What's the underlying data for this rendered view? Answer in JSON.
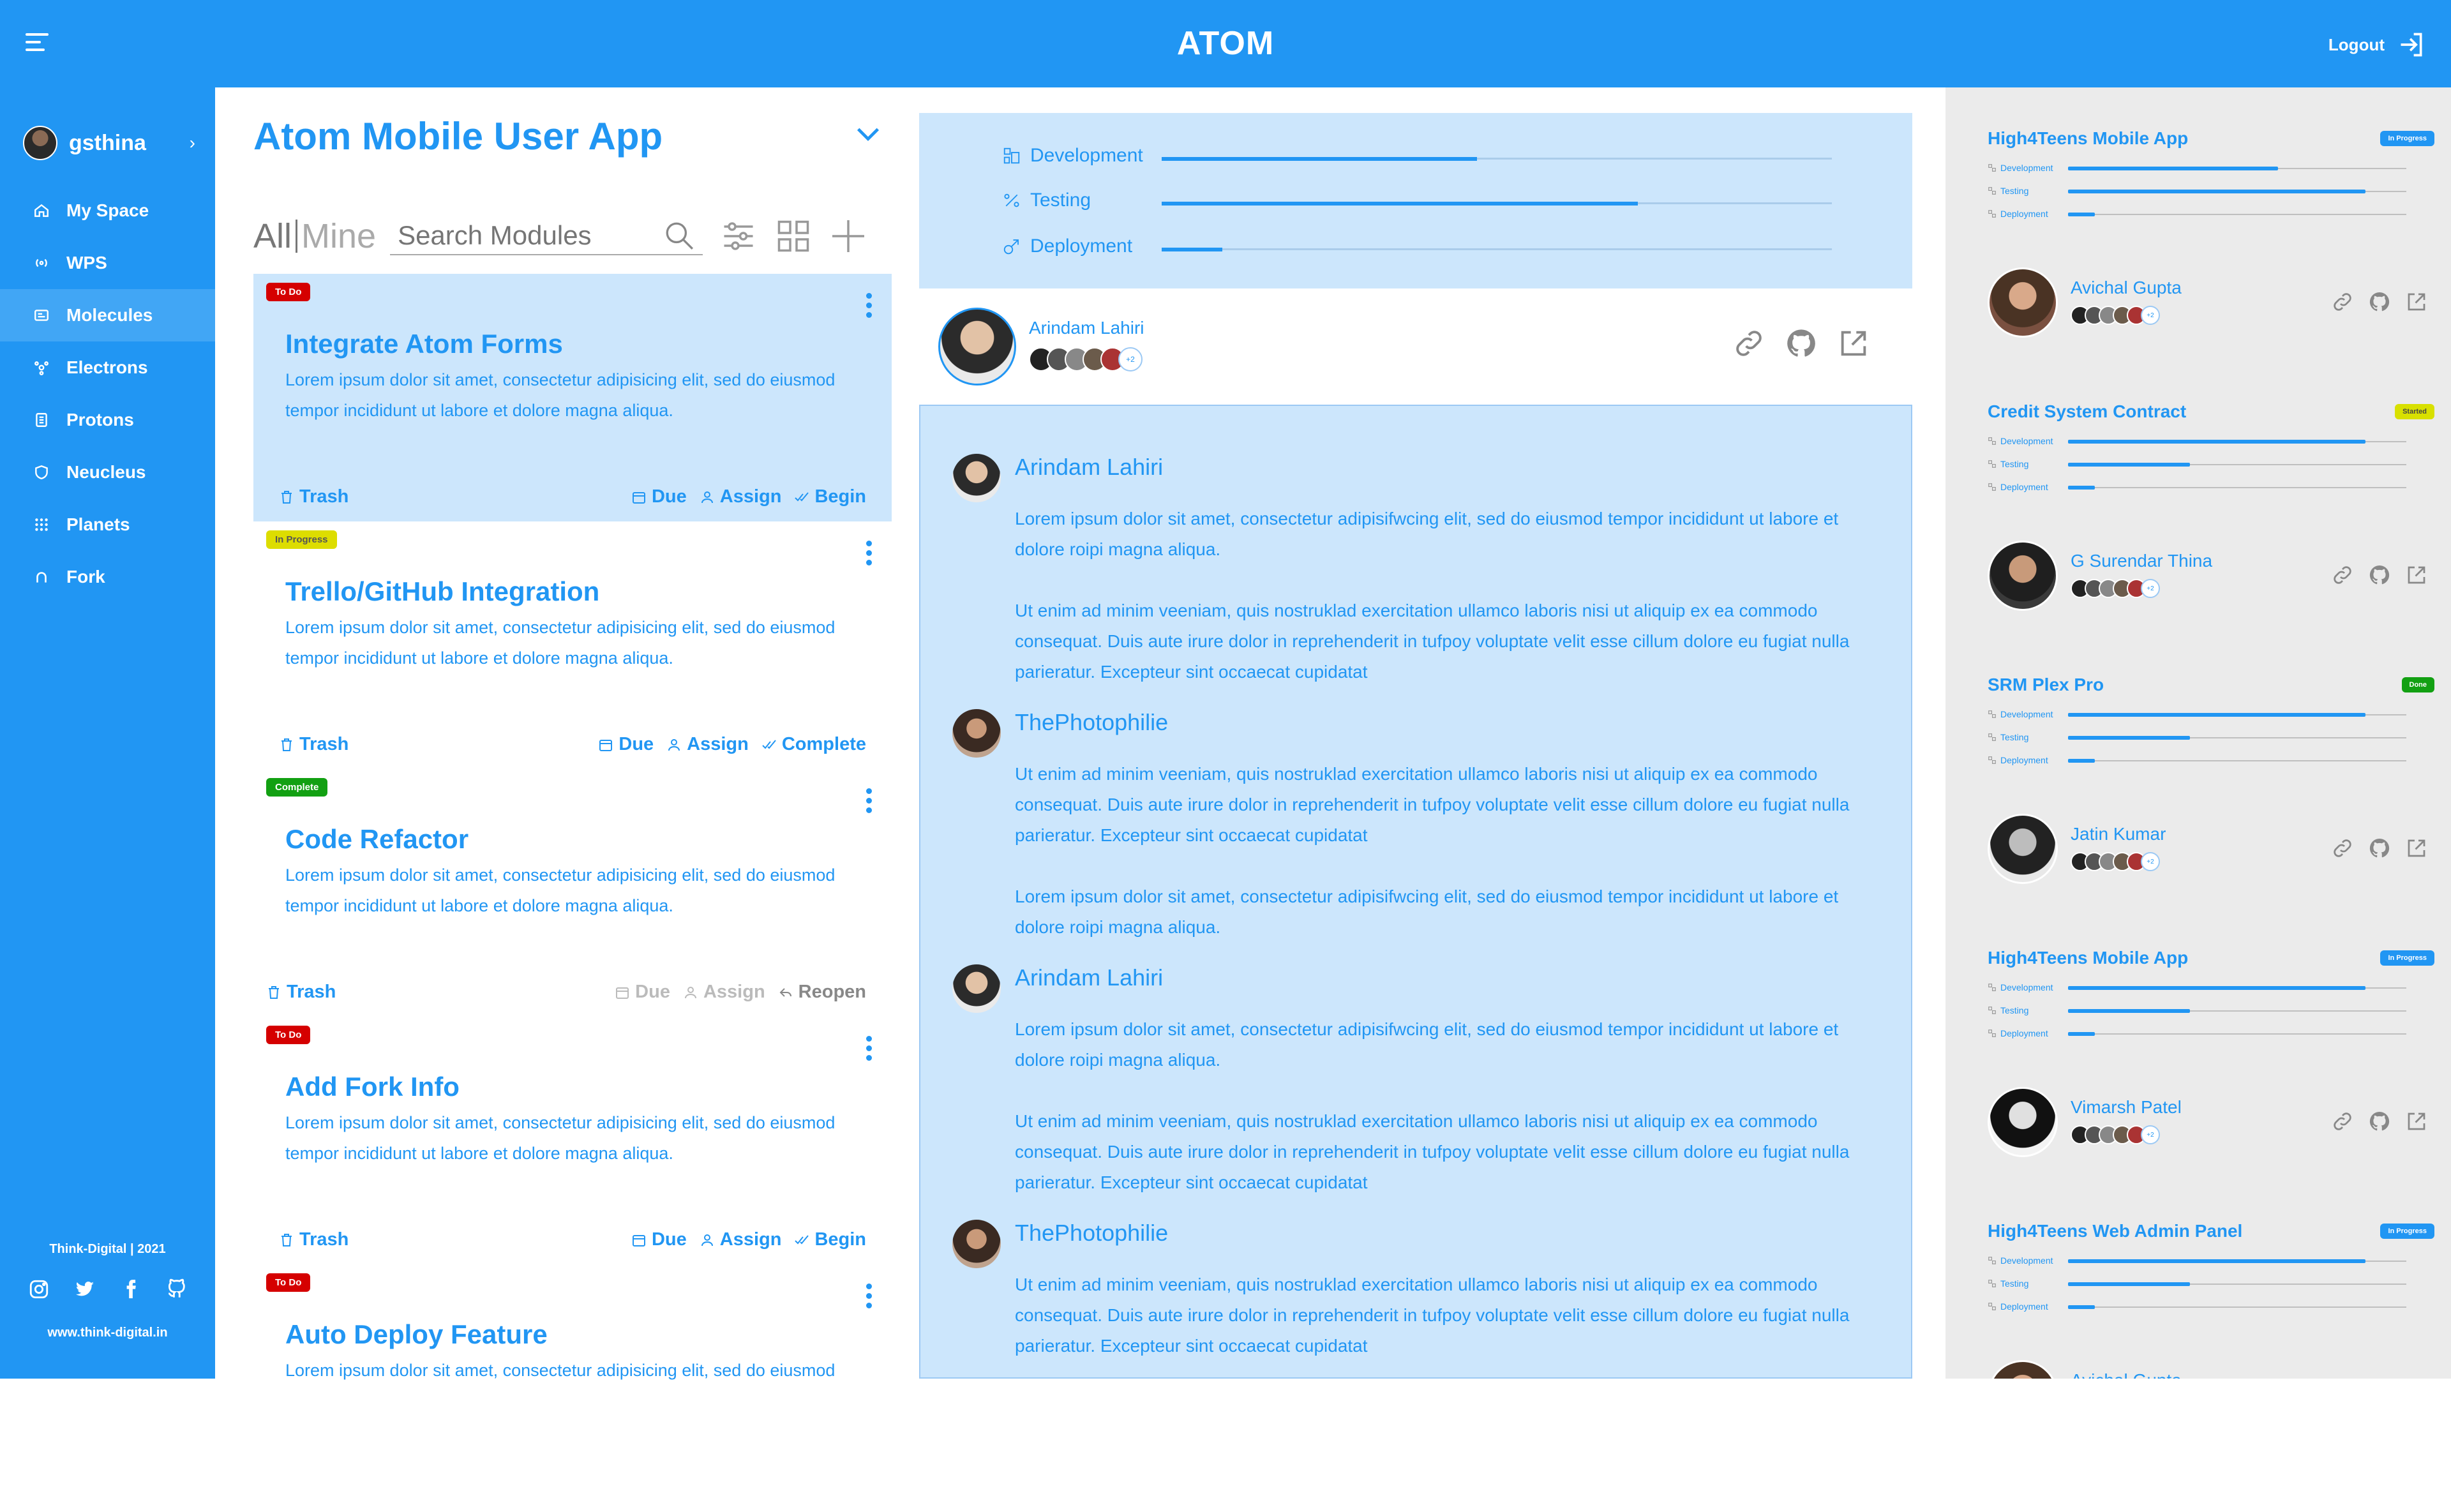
{
  "header": {
    "title": "ATOM",
    "logout_label": "Logout"
  },
  "sidebar": {
    "user": "gsthina",
    "items": [
      {
        "label": "My Space",
        "icon": "home-icon"
      },
      {
        "label": "WPS",
        "icon": "broadcast-icon"
      },
      {
        "label": "Molecules",
        "icon": "molecule-icon"
      },
      {
        "label": "Electrons",
        "icon": "electron-icon"
      },
      {
        "label": "Protons",
        "icon": "proton-icon"
      },
      {
        "label": "Neucleus",
        "icon": "shield-icon"
      },
      {
        "label": "Planets",
        "icon": "grid-dots-icon"
      },
      {
        "label": "Fork",
        "icon": "fork-icon"
      }
    ],
    "footer": {
      "company": "Think-Digital | 2021",
      "url": "www.think-digital.in"
    }
  },
  "modules": {
    "title": "Atom Mobile User App",
    "tab_all": "All",
    "tab_mine": "Mine",
    "search_placeholder": "Search Modules",
    "cards": [
      {
        "status": "To Do",
        "status_color": "#d50000",
        "title": "Integrate Atom Forms",
        "desc": "Lorem ipsum dolor sit amet, consectetur adipisicing elit, sed do eiusmod tempor incididunt ut labore et dolore magna aliqua.",
        "trash": "Trash",
        "due": "Due",
        "assign": "Assign",
        "action": "Begin"
      },
      {
        "status": "In Progress",
        "status_color": "#dddd00",
        "title": "Trello/GitHub Integration",
        "desc": "Lorem ipsum dolor sit amet, consectetur adipisicing elit, sed do eiusmod tempor incididunt ut labore et dolore magna aliqua.",
        "trash": "Trash",
        "due": "Due",
        "assign": "Assign",
        "action": "Complete"
      },
      {
        "status": "Complete",
        "status_color": "#12a012",
        "title": "Code Refactor",
        "desc": "Lorem ipsum dolor sit amet, consectetur adipisicing elit, sed do eiusmod tempor incididunt ut labore et dolore magna aliqua.",
        "trash": "Trash",
        "due": "Due",
        "assign": "Assign",
        "action": "Reopen"
      },
      {
        "status": "To Do",
        "status_color": "#d50000",
        "title": "Add Fork Info",
        "desc": "Lorem ipsum dolor sit amet, consectetur adipisicing elit, sed do eiusmod tempor incididunt ut labore et dolore magna aliqua.",
        "trash": "Trash",
        "due": "Due",
        "assign": "Assign",
        "action": "Begin"
      },
      {
        "status": "To Do",
        "status_color": "#d50000",
        "title": "Auto Deploy Feature",
        "desc": "Lorem ipsum dolor sit amet, consectetur adipisicing elit, sed do eiusmod"
      }
    ]
  },
  "detail": {
    "progress": [
      {
        "label": "Development",
        "value": 0.47
      },
      {
        "label": "Testing",
        "value": 0.71
      },
      {
        "label": "Deployment",
        "value": 0.09
      }
    ],
    "owner": "Arindam Lahiri",
    "more_count": "+2",
    "comments": [
      {
        "author": "Arindam Lahiri",
        "text": "Lorem ipsum dolor sit amet, consectetur adipisifwcing elit, sed do eiusmod tempor incididunt ut labore et dolore roipi magna aliqua.\n\nUt enim ad minim veeniam, quis nostruklad exercitation ullamco laboris nisi ut aliquip ex ea commodo consequat. Duis aute irure dolor in reprehenderit in tufpoy voluptate velit esse cillum dolore eu fugiat nulla parieratur. Excepteur sint occaecat cupidatat"
      },
      {
        "author": "ThePhotophilie",
        "text": "Ut enim ad minim veeniam, quis nostruklad exercitation ullamco laboris nisi ut aliquip ex ea commodo consequat. Duis aute irure dolor in reprehenderit in tufpoy voluptate velit esse cillum dolore eu fugiat nulla parieratur. Excepteur sint occaecat cupidatat\n\nLorem ipsum dolor sit amet, consectetur adipisifwcing elit, sed do eiusmod tempor incididunt ut labore et dolore roipi magna aliqua."
      },
      {
        "author": "Arindam Lahiri",
        "text": "Lorem ipsum dolor sit amet, consectetur adipisifwcing elit, sed do eiusmod tempor incididunt ut labore et dolore roipi magna aliqua.\n\nUt enim ad minim veeniam, quis nostruklad exercitation ullamco laboris nisi ut aliquip ex ea commodo consequat. Duis aute irure dolor in reprehenderit in tufpoy voluptate velit esse cillum dolore eu fugiat nulla parieratur. Excepteur sint occaecat cupidatat"
      },
      {
        "author": "ThePhotophilie",
        "text": "Ut enim ad minim veeniam, quis nostruklad exercitation ullamco laboris nisi ut aliquip ex ea commodo consequat. Duis aute irure dolor in reprehenderit in tufpoy voluptate velit esse cillum dolore eu fugiat nulla parieratur. Excepteur sint occaecat cupidatat"
      }
    ]
  },
  "projects": [
    {
      "title": "High4Teens Mobile App",
      "status": "In Progress",
      "status_color": "#2196f3",
      "dev": 0.62,
      "test": 0.88,
      "deploy": 0.08,
      "owner": "Avichal Gupta"
    },
    {
      "title": "Credit System Contract",
      "status": "Started",
      "status_color": "#d8e000",
      "dev": 0.88,
      "test": 0.36,
      "deploy": 0.08,
      "owner": "G Surendar Thina"
    },
    {
      "title": "SRM Plex Pro",
      "status": "Done",
      "status_color": "#12a012",
      "dev": 0.88,
      "test": 0.36,
      "deploy": 0.08,
      "owner": "Jatin Kumar"
    },
    {
      "title": "High4Teens Mobile App",
      "status": "In Progress",
      "status_color": "#2196f3",
      "dev": 0.88,
      "test": 0.36,
      "deploy": 0.08,
      "owner": "Vimarsh Patel"
    },
    {
      "title": "High4Teens Web Admin Panel",
      "status": "In Progress",
      "status_color": "#2196f3",
      "dev": 0.88,
      "test": 0.36,
      "deploy": 0.08,
      "owner": "Avichal Gupta"
    }
  ],
  "project_labels": {
    "dev": "Development",
    "test": "Testing",
    "deploy": "Deployment",
    "more": "+2"
  }
}
